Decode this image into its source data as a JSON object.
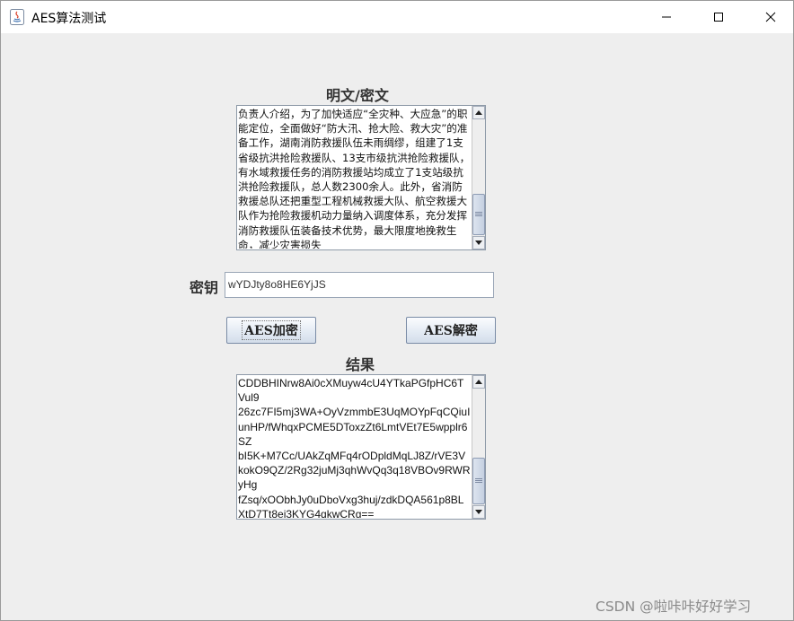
{
  "window": {
    "title": "AES算法测试"
  },
  "plaintext": {
    "label": "明文/密文",
    "text": "负责人介绍，为了加快适应“全灾种、大应急”的职能定位，全面做好“防大汛、抢大险、救大灾”的准备工作，湖南消防救援队伍未雨绸缪，组建了1支省级抗洪抢险救援队、13支市级抗洪抢险救援队，有水域救援任务的消防救援站均成立了1支站级抗洪抢险救援队，总人数2300余人。此外，省消防救援总队还把重型工程机械救援大队、航空救援大队作为抢险救援机动力量纳入调度体系，充分发挥消防救援队伍装备技术优势，最大限度地挽救生命，减少灾害损失"
  },
  "key": {
    "label": "密钥",
    "value": "wYDJty8o8HE6YjJS"
  },
  "buttons": {
    "encrypt": "AES加密",
    "decrypt": "AES解密"
  },
  "result": {
    "label": "结果",
    "text": "CDDBHINrw8Ai0cXMuyw4cU4YTkaPGfpHC6TVul9\n26zc7FI5mj3WA+OyVzmmbE3UqMOYpFqCQiuIunHP/fWhqxPCME5DToxzZt6LmtVEt7E5wpplr6SZ\nbI5K+M7Cc/UAkZqMFq4rODpldMqLJ8Z/rVE3VkokO9QZ/2Rg32juMj3qhWvQq3q18VBOv9RWRyHg\nfZsq/xOObhJy0uDboVxg3huj/zdkDQA561p8BLXtD7Tt8ei3KYG4qkwCRg=="
  },
  "watermark": "CSDN @啦咔咔好好学习"
}
